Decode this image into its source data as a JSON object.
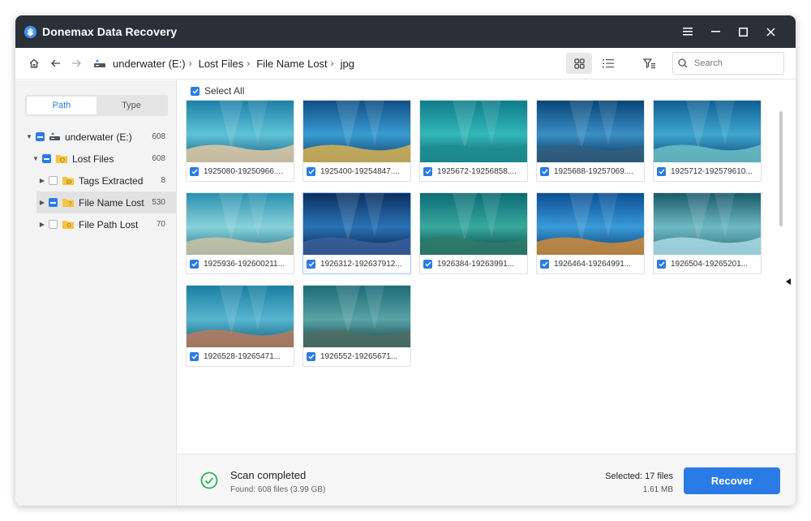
{
  "app": {
    "title": "Donemax Data Recovery"
  },
  "breadcrumb": [
    "underwater (E:)",
    "Lost Files",
    "File Name Lost",
    "jpg"
  ],
  "search": {
    "placeholder": "Search"
  },
  "sidebar": {
    "tabs": [
      "Path",
      "Type"
    ],
    "tree": [
      {
        "label": "underwater (E:)",
        "count": "608"
      },
      {
        "label": "Lost Files",
        "count": "608"
      },
      {
        "label": "Tags Extracted",
        "count": "8"
      },
      {
        "label": "File Name Lost",
        "count": "530"
      },
      {
        "label": "File Path Lost",
        "count": "70"
      }
    ]
  },
  "main": {
    "select_all_label": "Select All",
    "files": [
      "1925080-19250966....",
      "1925400-19254847....",
      "1925672-19256858....",
      "1925688-19257069....",
      "1925712-192579610...",
      "1925936-192600211...",
      "1926312-192637912...",
      "1926384-19263991...",
      "1926464-19264991...",
      "1926504-19265201...",
      "1926528-19265471...",
      "1926552-19265671..."
    ]
  },
  "status": {
    "title": "Scan completed",
    "subtitle": "Found: 608 files (3.99 GB)",
    "selected": "Selected: 17 files",
    "size": "1.61 MB",
    "recover_label": "Recover"
  },
  "colors": {
    "accent": "#2a7be5",
    "titlebar": "#2b2f38"
  }
}
